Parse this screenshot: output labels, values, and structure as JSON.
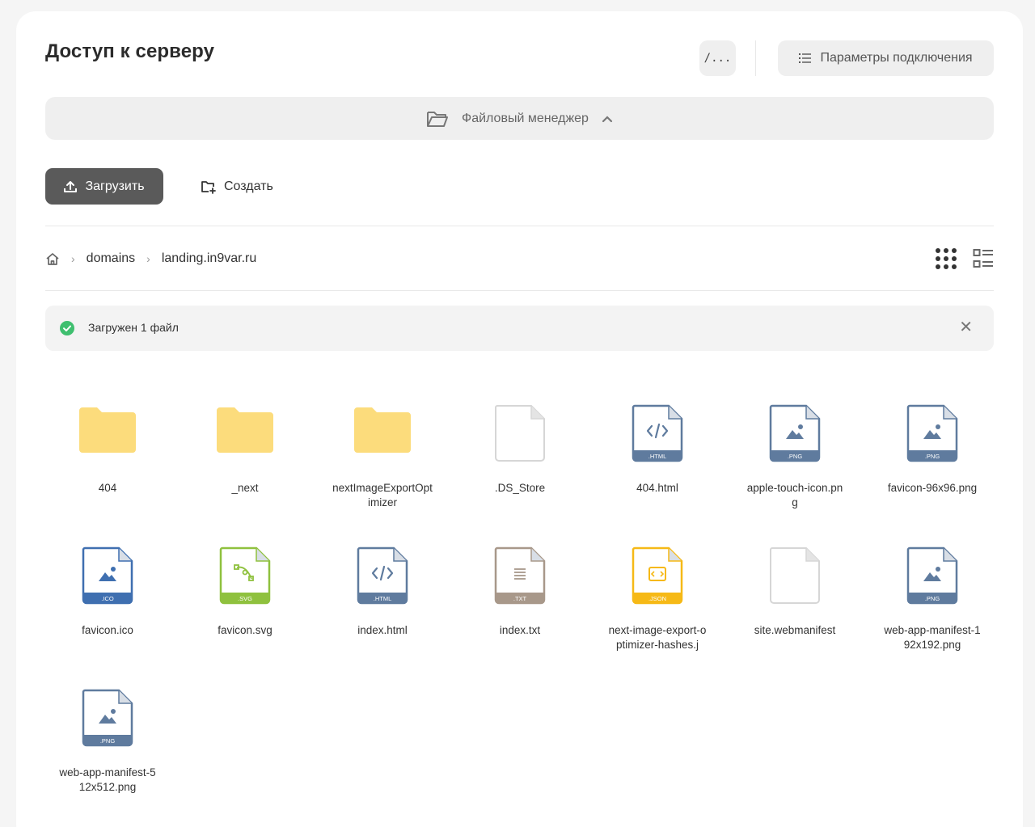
{
  "header": {
    "title": "Доступ к серверу",
    "terminal_label": "/...",
    "params_label": "Параметры подключения"
  },
  "file_manager": {
    "label": "Файловый менеджер"
  },
  "toolbar": {
    "upload_label": "Загрузить",
    "create_label": "Создать"
  },
  "breadcrumb": {
    "items": [
      "domains",
      "landing.in9var.ru"
    ]
  },
  "notice": {
    "text": "Загружен 1 файл"
  },
  "files": [
    {
      "name": "404",
      "type": "folder"
    },
    {
      "name": "_next",
      "type": "folder"
    },
    {
      "name": "nextImageExportOptimizer",
      "type": "folder"
    },
    {
      "name": ".DS_Store",
      "type": "blank"
    },
    {
      "name": "404.html",
      "type": "html",
      "badge": ".HTML"
    },
    {
      "name": "apple-touch-icon.png",
      "type": "image",
      "badge": ".PNG"
    },
    {
      "name": "favicon-96x96.png",
      "type": "image",
      "badge": ".PNG"
    },
    {
      "name": "favicon.ico",
      "type": "ico",
      "badge": ".ICO"
    },
    {
      "name": "favicon.svg",
      "type": "svg",
      "badge": ".SVG"
    },
    {
      "name": "index.html",
      "type": "html",
      "badge": ".HTML"
    },
    {
      "name": "index.txt",
      "type": "txt",
      "badge": ".TXT"
    },
    {
      "name": "next-image-export-optimizer-hashes.j",
      "type": "json",
      "badge": ".JSON"
    },
    {
      "name": "site.webmanifest",
      "type": "blank"
    },
    {
      "name": "web-app-manifest-192x192.png",
      "type": "image",
      "badge": ".PNG"
    },
    {
      "name": "web-app-manifest-512x512.png",
      "type": "image",
      "badge": ".PNG"
    }
  ],
  "colors": {
    "folder": "#fcdc7c",
    "html": "#5f7b9e",
    "image": "#5f7b9e",
    "ico": "#3f6fb0",
    "svg": "#8fc13e",
    "txt": "#a8988a",
    "json": "#f6b916",
    "success": "#3fbf6f"
  }
}
